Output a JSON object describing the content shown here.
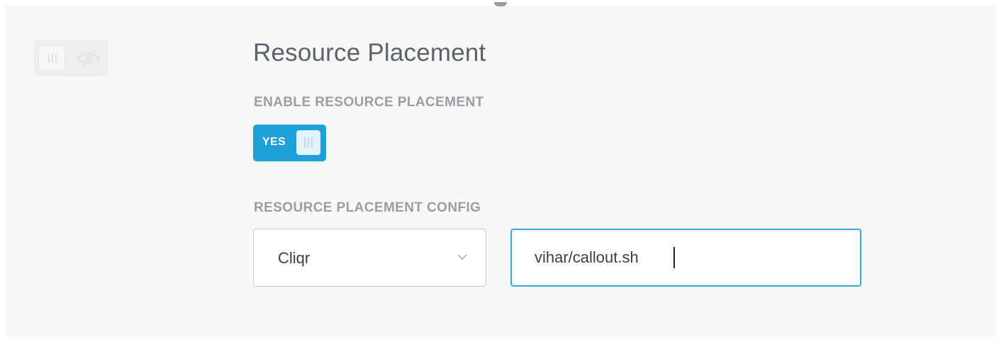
{
  "section": {
    "title": "Resource Placement"
  },
  "enable": {
    "label": "ENABLE RESOURCE PLACEMENT",
    "toggle_text": "YES",
    "toggle_state": true,
    "accent_color": "#1fa0d8"
  },
  "config": {
    "label": "RESOURCE PLACEMENT CONFIG",
    "select_value": "Cliqr",
    "input_value": "vihar/callout.sh",
    "input_focus_color": "#3fa6d8"
  },
  "visibility_toggle": {
    "icon": "eye-slash-icon",
    "state": false
  }
}
